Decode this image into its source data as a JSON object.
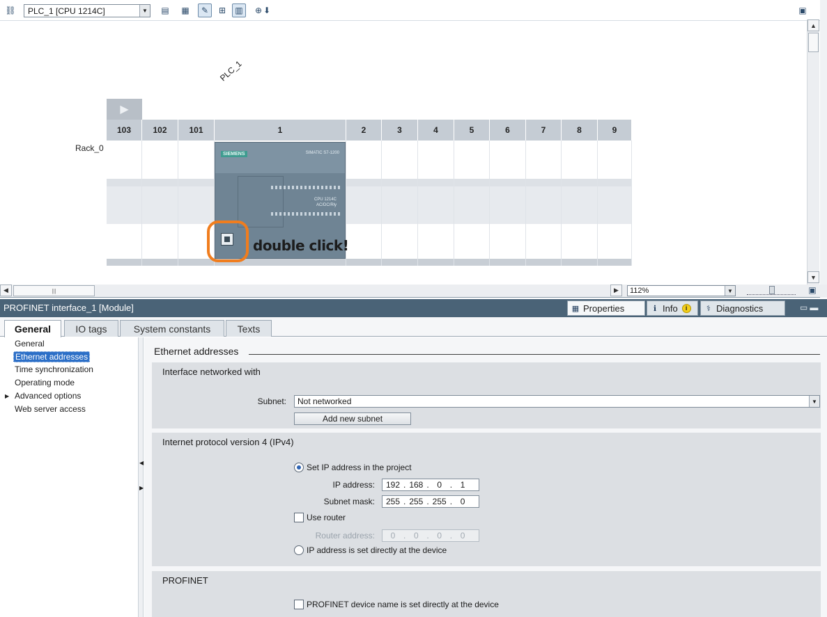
{
  "device_view": {
    "device_selector": "PLC_1 [CPU 1214C]",
    "plc_name": "PLC_1",
    "rack_name": "Rack_0",
    "slots": [
      "103",
      "102",
      "101",
      "1",
      "2",
      "3",
      "4",
      "5",
      "6",
      "7",
      "8",
      "9"
    ],
    "cpu_module": {
      "brand": "SIEMENS",
      "series": "SIMATIC S7-1200",
      "model_line1": "CPU 1214C",
      "model_line2": "AC/DC/Rly"
    },
    "annotation": "double click!",
    "zoom_level": "112%"
  },
  "inspector": {
    "title": "PROFINET interface_1 [Module]",
    "tabs": [
      {
        "label": "Properties",
        "icon": "properties-icon",
        "active": true
      },
      {
        "label": "Info",
        "icon": "info-icon",
        "active": false
      },
      {
        "label": "Diagnostics",
        "icon": "diagnostics-icon",
        "active": false
      }
    ],
    "subtabs": [
      "General",
      "IO tags",
      "System constants",
      "Texts"
    ],
    "nav_items": [
      {
        "label": "General",
        "selected": false,
        "expandable": false
      },
      {
        "label": "Ethernet addresses",
        "selected": true,
        "expandable": false
      },
      {
        "label": "Time synchronization",
        "selected": false,
        "expandable": false
      },
      {
        "label": "Operating mode",
        "selected": false,
        "expandable": false
      },
      {
        "label": "Advanced options",
        "selected": false,
        "expandable": true
      },
      {
        "label": "Web server access",
        "selected": false,
        "expandable": false
      }
    ]
  },
  "ethernet": {
    "heading": "Ethernet addresses",
    "interface_section": {
      "title": "Interface networked with",
      "subnet_label": "Subnet:",
      "subnet_value": "Not networked",
      "add_subnet_button": "Add new subnet"
    },
    "ipv4_section": {
      "title": "Internet protocol version 4 (IPv4)",
      "set_ip_option": "Set IP address in the project",
      "set_ip_selected": true,
      "ip_label": "IP address:",
      "ip_address": [
        "192",
        "168",
        "0",
        "1"
      ],
      "mask_label": "Subnet mask:",
      "subnet_mask": [
        "255",
        "255",
        "255",
        "0"
      ],
      "use_router_label": "Use router",
      "use_router_checked": false,
      "router_label": "Router address:",
      "router_address": [
        "0",
        "0",
        "0",
        "0"
      ],
      "direct_ip_option": "IP address is set directly at the device",
      "direct_ip_selected": false
    },
    "profinet_section": {
      "title": "PROFINET",
      "device_name_option": "PROFINET device name is set directly at the device",
      "device_name_checked": false
    }
  },
  "colors": {
    "title_bar": "#4a6377",
    "selection": "#2c6fc7",
    "highlight_ring": "#f07d1e",
    "section_bg": "#dcdfe3"
  }
}
